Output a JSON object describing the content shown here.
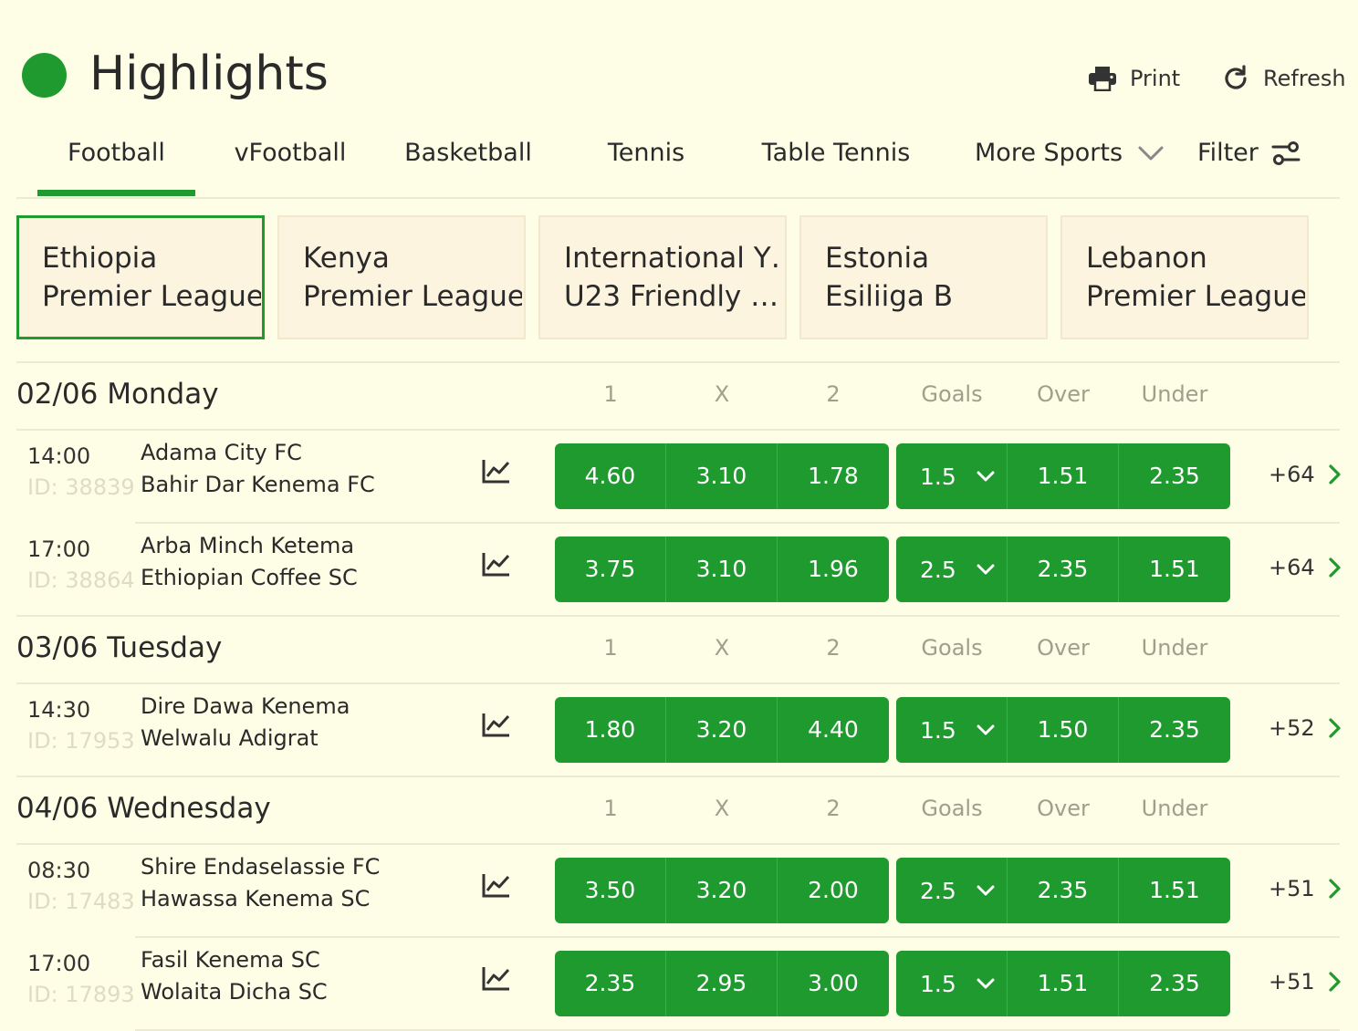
{
  "header": {
    "title": "Highlights",
    "print_label": "Print",
    "refresh_label": "Refresh"
  },
  "tabs": [
    {
      "label": "Football",
      "active": true
    },
    {
      "label": "vFootball"
    },
    {
      "label": "Basketball"
    },
    {
      "label": "Tennis"
    },
    {
      "label": "Table Tennis"
    },
    {
      "label": "More Sports"
    },
    {
      "label": "Filter"
    }
  ],
  "leagues": [
    {
      "line1": "Ethiopia",
      "line2": "Premier League",
      "active": true
    },
    {
      "line1": "Kenya",
      "line2": "Premier League"
    },
    {
      "line1": "International Y…",
      "line2": "U23 Friendly …"
    },
    {
      "line1": "Estonia",
      "line2": "Esiliiga B"
    },
    {
      "line1": "Lebanon",
      "line2": "Premier League"
    }
  ],
  "columns": {
    "c1": "1",
    "cx": "X",
    "c2": "2",
    "goals": "Goals",
    "over": "Over",
    "under": "Under"
  },
  "days": [
    {
      "date": "02/06 Monday",
      "matches": [
        {
          "time": "14:00",
          "id": "ID: 38839",
          "home": "Adama City FC",
          "away": "Bahir Dar Kenema FC",
          "odds": [
            "4.60",
            "3.10",
            "1.78"
          ],
          "goals": "1.5",
          "over": "1.51",
          "under": "2.35",
          "more": "+64"
        },
        {
          "time": "17:00",
          "id": "ID: 38864",
          "home": "Arba Minch Ketema",
          "away": "Ethiopian Coffee SC",
          "odds": [
            "3.75",
            "3.10",
            "1.96"
          ],
          "goals": "2.5",
          "over": "2.35",
          "under": "1.51",
          "more": "+64"
        }
      ]
    },
    {
      "date": "03/06 Tuesday",
      "matches": [
        {
          "time": "14:30",
          "id": "ID: 17953",
          "home": "Dire Dawa Kenema",
          "away": "Welwalu Adigrat",
          "odds": [
            "1.80",
            "3.20",
            "4.40"
          ],
          "goals": "1.5",
          "over": "1.50",
          "under": "2.35",
          "more": "+52"
        }
      ]
    },
    {
      "date": "04/06 Wednesday",
      "matches": [
        {
          "time": "08:30",
          "id": "ID: 17483",
          "home": "Shire Endaselassie FC",
          "away": "Hawassa Kenema SC",
          "odds": [
            "3.50",
            "3.20",
            "2.00"
          ],
          "goals": "2.5",
          "over": "2.35",
          "under": "1.51",
          "more": "+51"
        },
        {
          "time": "17:00",
          "id": "ID: 17893",
          "home": "Fasil Kenema SC",
          "away": "Wolaita Dicha SC",
          "odds": [
            "2.35",
            "2.95",
            "3.00"
          ],
          "goals": "1.5",
          "over": "1.51",
          "under": "2.35",
          "more": "+51"
        }
      ]
    }
  ],
  "colors": {
    "brand_green": "#1f9a2e",
    "background": "#fefee6",
    "card": "#fdf4df"
  },
  "icons": [
    "status-dot-icon",
    "printer-icon",
    "refresh-icon",
    "chevron-down-icon",
    "filter-sliders-icon",
    "stats-chart-icon",
    "chevron-right-icon"
  ]
}
